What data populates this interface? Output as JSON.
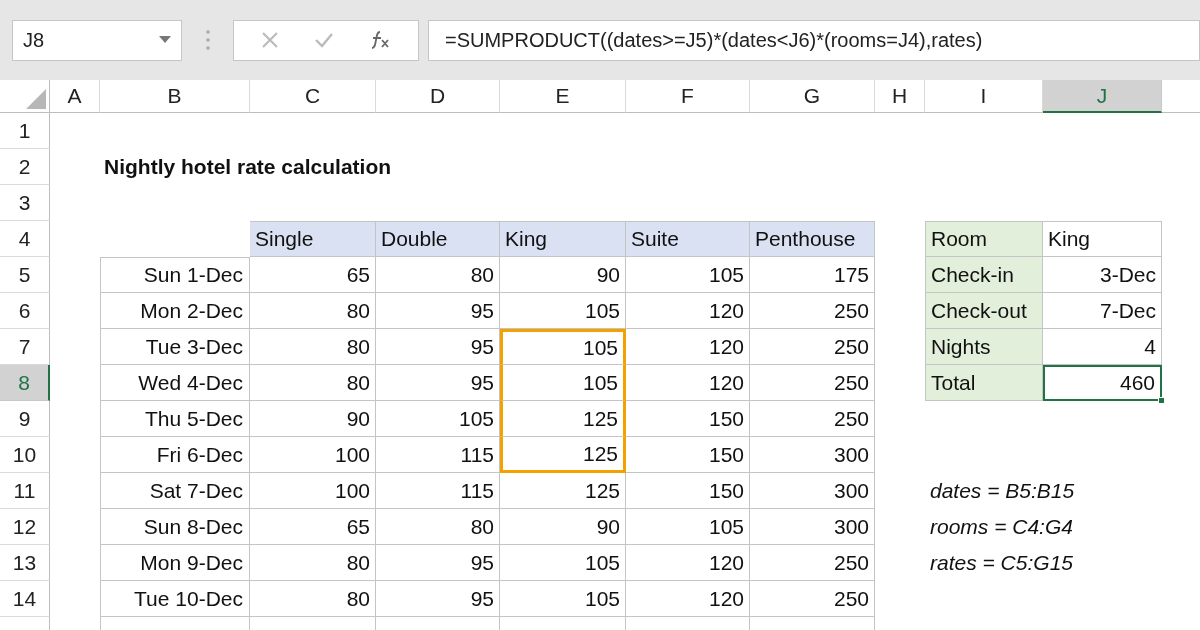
{
  "name_box": "J8",
  "formula": "=SUMPRODUCT((dates>=J5)*(dates<J6)*(rooms=J4),rates)",
  "columns": [
    {
      "label": "A",
      "selected": false
    },
    {
      "label": "B",
      "selected": false
    },
    {
      "label": "C",
      "selected": false
    },
    {
      "label": "D",
      "selected": false
    },
    {
      "label": "E",
      "selected": false
    },
    {
      "label": "F",
      "selected": false
    },
    {
      "label": "G",
      "selected": false
    },
    {
      "label": "H",
      "selected": false
    },
    {
      "label": "I",
      "selected": false
    },
    {
      "label": "J",
      "selected": true
    }
  ],
  "rows": [
    {
      "label": "1",
      "selected": false
    },
    {
      "label": "2",
      "selected": false
    },
    {
      "label": "3",
      "selected": false
    },
    {
      "label": "4",
      "selected": false
    },
    {
      "label": "5",
      "selected": false
    },
    {
      "label": "6",
      "selected": false
    },
    {
      "label": "7",
      "selected": false
    },
    {
      "label": "8",
      "selected": true
    },
    {
      "label": "9",
      "selected": false
    },
    {
      "label": "10",
      "selected": false
    },
    {
      "label": "11",
      "selected": false
    },
    {
      "label": "12",
      "selected": false
    },
    {
      "label": "13",
      "selected": false
    },
    {
      "label": "14",
      "selected": false
    }
  ],
  "title": "Nightly hotel rate calculation",
  "rate_table": {
    "columns": [
      "Single",
      "Double",
      "King",
      "Suite",
      "Penthouse"
    ],
    "rows": [
      {
        "date": "Sun 1-Dec",
        "rates": [
          {
            "text": "65",
            "highlighted": false
          },
          {
            "text": "80",
            "highlighted": false
          },
          {
            "text": "90",
            "highlighted": false
          },
          {
            "text": "105",
            "highlighted": false
          },
          {
            "text": "175",
            "highlighted": false
          }
        ]
      },
      {
        "date": "Mon 2-Dec",
        "rates": [
          {
            "text": "80",
            "highlighted": false
          },
          {
            "text": "95",
            "highlighted": false
          },
          {
            "text": "105",
            "highlighted": false
          },
          {
            "text": "120",
            "highlighted": false
          },
          {
            "text": "250",
            "highlighted": false
          }
        ]
      },
      {
        "date": "Tue 3-Dec",
        "rates": [
          {
            "text": "80",
            "highlighted": false
          },
          {
            "text": "95",
            "highlighted": false
          },
          {
            "text": "105",
            "highlighted": true
          },
          {
            "text": "120",
            "highlighted": false
          },
          {
            "text": "250",
            "highlighted": false
          }
        ]
      },
      {
        "date": "Wed 4-Dec",
        "rates": [
          {
            "text": "80",
            "highlighted": false
          },
          {
            "text": "95",
            "highlighted": false
          },
          {
            "text": "105",
            "highlighted": true
          },
          {
            "text": "120",
            "highlighted": false
          },
          {
            "text": "250",
            "highlighted": false
          }
        ]
      },
      {
        "date": "Thu 5-Dec",
        "rates": [
          {
            "text": "90",
            "highlighted": false
          },
          {
            "text": "105",
            "highlighted": false
          },
          {
            "text": "125",
            "highlighted": true
          },
          {
            "text": "150",
            "highlighted": false
          },
          {
            "text": "250",
            "highlighted": false
          }
        ]
      },
      {
        "date": "Fri 6-Dec",
        "rates": [
          {
            "text": "100",
            "highlighted": false
          },
          {
            "text": "115",
            "highlighted": false
          },
          {
            "text": "125",
            "highlighted": true
          },
          {
            "text": "150",
            "highlighted": false
          },
          {
            "text": "300",
            "highlighted": false
          }
        ]
      },
      {
        "date": "Sat 7-Dec",
        "rates": [
          {
            "text": "100",
            "highlighted": false
          },
          {
            "text": "115",
            "highlighted": false
          },
          {
            "text": "125",
            "highlighted": false
          },
          {
            "text": "150",
            "highlighted": false
          },
          {
            "text": "300",
            "highlighted": false
          }
        ]
      },
      {
        "date": "Sun 8-Dec",
        "rates": [
          {
            "text": "65",
            "highlighted": false
          },
          {
            "text": "80",
            "highlighted": false
          },
          {
            "text": "90",
            "highlighted": false
          },
          {
            "text": "105",
            "highlighted": false
          },
          {
            "text": "300",
            "highlighted": false
          }
        ]
      },
      {
        "date": "Mon 9-Dec",
        "rates": [
          {
            "text": "80",
            "highlighted": false
          },
          {
            "text": "95",
            "highlighted": false
          },
          {
            "text": "105",
            "highlighted": false
          },
          {
            "text": "120",
            "highlighted": false
          },
          {
            "text": "250",
            "highlighted": false
          }
        ]
      },
      {
        "date": "Tue 10-Dec",
        "rates": [
          {
            "text": "80",
            "highlighted": false
          },
          {
            "text": "95",
            "highlighted": false
          },
          {
            "text": "105",
            "highlighted": false
          },
          {
            "text": "120",
            "highlighted": false
          },
          {
            "text": "250",
            "highlighted": false
          }
        ]
      }
    ]
  },
  "lookup": [
    {
      "label": "Room",
      "value": "King",
      "kind": "text",
      "selected": false
    },
    {
      "label": "Check-in",
      "value": "3-Dec",
      "kind": "number",
      "selected": false
    },
    {
      "label": "Check-out",
      "value": "7-Dec",
      "kind": "number",
      "selected": false
    },
    {
      "label": "Nights",
      "value": "4",
      "kind": "number",
      "selected": false
    },
    {
      "label": "Total",
      "value": "460",
      "kind": "number",
      "selected": true
    }
  ],
  "named_ranges": [
    "dates = B5:B15",
    "rooms = C4:G4",
    "rates = C5:G15"
  ]
}
